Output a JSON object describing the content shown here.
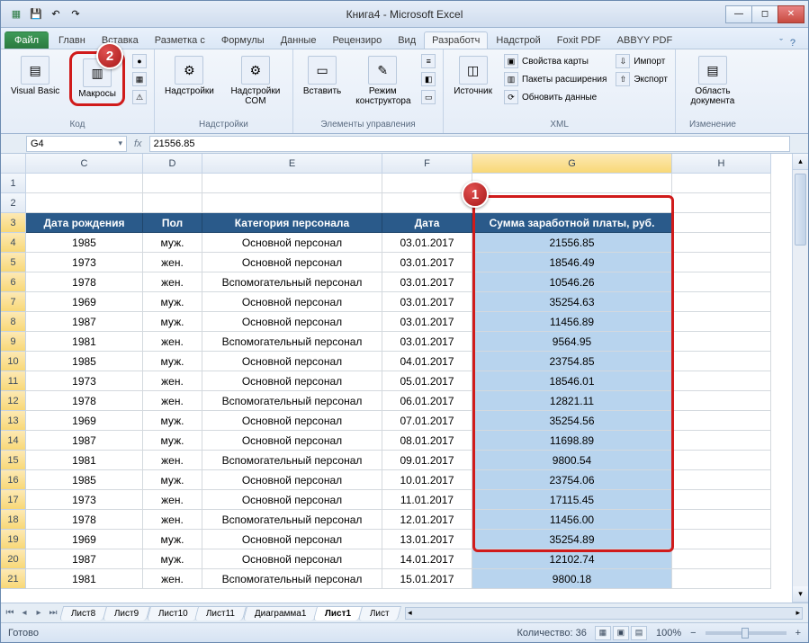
{
  "window": {
    "title": "Книга4 - Microsoft Excel"
  },
  "tabs": {
    "file": "Файл",
    "items": [
      "Главн",
      "Вставка",
      "Разметка с",
      "Формулы",
      "Данные",
      "Рецензиро",
      "Вид",
      "Разработч",
      "Надстрой",
      "Foxit PDF",
      "ABBYY PDF"
    ],
    "active_index": 7
  },
  "ribbon": {
    "groups": [
      {
        "label": "Код",
        "big": [
          {
            "name": "visual-basic",
            "text": "Visual Basic"
          },
          {
            "name": "macros",
            "text": "Макросы"
          }
        ],
        "small": []
      },
      {
        "label": "Надстройки",
        "big": [
          {
            "name": "addins",
            "text": "Надстройки"
          },
          {
            "name": "com-addins",
            "text": "Надстройки COM"
          }
        ]
      },
      {
        "label": "Элементы управления",
        "big": [
          {
            "name": "insert",
            "text": "Вставить"
          },
          {
            "name": "design-mode",
            "text": "Режим конструктора"
          }
        ]
      },
      {
        "label": "XML",
        "big": [
          {
            "name": "source",
            "text": "Источник"
          }
        ],
        "small": [
          "Свойства карты",
          "Пакеты расширения",
          "Обновить данные",
          "Импорт",
          "Экспорт"
        ]
      },
      {
        "label": "Изменение",
        "big": [
          {
            "name": "doc-panel",
            "text": "Область документа"
          }
        ]
      }
    ]
  },
  "namebox": "G4",
  "formula": "21556.85",
  "columns": [
    "C",
    "D",
    "E",
    "F",
    "G",
    "H"
  ],
  "headers": [
    "Дата рождения",
    "Пол",
    "Категория персонала",
    "Дата",
    "Сумма заработной платы, руб."
  ],
  "rows": [
    {
      "r": 4,
      "birth": "1985",
      "sex": "муж.",
      "cat": "Основной персонал",
      "date": "03.01.2017",
      "sum": "21556.85"
    },
    {
      "r": 5,
      "birth": "1973",
      "sex": "жен.",
      "cat": "Основной персонал",
      "date": "03.01.2017",
      "sum": "18546.49"
    },
    {
      "r": 6,
      "birth": "1978",
      "sex": "жен.",
      "cat": "Вспомогательный персонал",
      "date": "03.01.2017",
      "sum": "10546.26"
    },
    {
      "r": 7,
      "birth": "1969",
      "sex": "муж.",
      "cat": "Основной персонал",
      "date": "03.01.2017",
      "sum": "35254.63"
    },
    {
      "r": 8,
      "birth": "1987",
      "sex": "муж.",
      "cat": "Основной персонал",
      "date": "03.01.2017",
      "sum": "11456.89"
    },
    {
      "r": 9,
      "birth": "1981",
      "sex": "жен.",
      "cat": "Вспомогательный персонал",
      "date": "03.01.2017",
      "sum": "9564.95"
    },
    {
      "r": 10,
      "birth": "1985",
      "sex": "муж.",
      "cat": "Основной персонал",
      "date": "04.01.2017",
      "sum": "23754.85"
    },
    {
      "r": 11,
      "birth": "1973",
      "sex": "жен.",
      "cat": "Основной персонал",
      "date": "05.01.2017",
      "sum": "18546.01"
    },
    {
      "r": 12,
      "birth": "1978",
      "sex": "жен.",
      "cat": "Вспомогательный персонал",
      "date": "06.01.2017",
      "sum": "12821.11"
    },
    {
      "r": 13,
      "birth": "1969",
      "sex": "муж.",
      "cat": "Основной персонал",
      "date": "07.01.2017",
      "sum": "35254.56"
    },
    {
      "r": 14,
      "birth": "1987",
      "sex": "муж.",
      "cat": "Основной персонал",
      "date": "08.01.2017",
      "sum": "11698.89"
    },
    {
      "r": 15,
      "birth": "1981",
      "sex": "жен.",
      "cat": "Вспомогательный персонал",
      "date": "09.01.2017",
      "sum": "9800.54"
    },
    {
      "r": 16,
      "birth": "1985",
      "sex": "муж.",
      "cat": "Основной персонал",
      "date": "10.01.2017",
      "sum": "23754.06"
    },
    {
      "r": 17,
      "birth": "1973",
      "sex": "жен.",
      "cat": "Основной персонал",
      "date": "11.01.2017",
      "sum": "17115.45"
    },
    {
      "r": 18,
      "birth": "1978",
      "sex": "жен.",
      "cat": "Вспомогательный персонал",
      "date": "12.01.2017",
      "sum": "11456.00"
    },
    {
      "r": 19,
      "birth": "1969",
      "sex": "муж.",
      "cat": "Основной персонал",
      "date": "13.01.2017",
      "sum": "35254.89"
    },
    {
      "r": 20,
      "birth": "1987",
      "sex": "муж.",
      "cat": "Основной персонал",
      "date": "14.01.2017",
      "sum": "12102.74"
    },
    {
      "r": 21,
      "birth": "1981",
      "sex": "жен.",
      "cat": "Вспомогательный персонал",
      "date": "15.01.2017",
      "sum": "9800.18"
    }
  ],
  "sheets": [
    "Лист8",
    "Лист9",
    "Лист10",
    "Лист11",
    "Диаграмма1",
    "Лист1",
    "Лист"
  ],
  "active_sheet": 5,
  "status": {
    "ready": "Готово",
    "count_label": "Количество: 36",
    "zoom": "100%"
  },
  "markers": {
    "one": "1",
    "two": "2"
  }
}
